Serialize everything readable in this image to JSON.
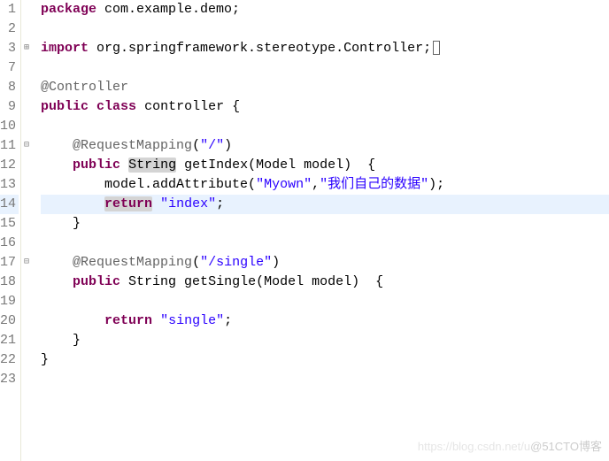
{
  "lines": [
    {
      "n": "1",
      "marker": ""
    },
    {
      "n": "2",
      "marker": ""
    },
    {
      "n": "3",
      "marker": "plus"
    },
    {
      "n": "7",
      "marker": ""
    },
    {
      "n": "8",
      "marker": ""
    },
    {
      "n": "9",
      "marker": ""
    },
    {
      "n": "10",
      "marker": ""
    },
    {
      "n": "11",
      "marker": "minus"
    },
    {
      "n": "12",
      "marker": ""
    },
    {
      "n": "13",
      "marker": ""
    },
    {
      "n": "14",
      "marker": ""
    },
    {
      "n": "15",
      "marker": ""
    },
    {
      "n": "16",
      "marker": ""
    },
    {
      "n": "17",
      "marker": "minus"
    },
    {
      "n": "18",
      "marker": ""
    },
    {
      "n": "19",
      "marker": ""
    },
    {
      "n": "20",
      "marker": ""
    },
    {
      "n": "21",
      "marker": ""
    },
    {
      "n": "22",
      "marker": ""
    },
    {
      "n": "23",
      "marker": ""
    }
  ],
  "code": {
    "l1": {
      "kw1": "package",
      "pkg": " com.example.demo;"
    },
    "l3": {
      "kw1": "import",
      "pkg": " org.springframework.stereotype.Controller;"
    },
    "l8": {
      "ann": "@Controller"
    },
    "l9": {
      "kw1": "public",
      "kw2": "class",
      "name": " controller {"
    },
    "l11": {
      "ann": "@RequestMapping",
      "args": "(",
      "str": "\"/\"",
      "close": ")"
    },
    "l12": {
      "kw1": "public",
      "type": "String",
      "rest": " getIndex(Model model)  {"
    },
    "l13": {
      "pre": "model.addAttribute(",
      "str1": "\"Myown\"",
      "mid": ",",
      "str2": "\"我们自己的数据\"",
      "post": ");"
    },
    "l14": {
      "kw1": "return",
      "sp": " ",
      "str": "\"index\"",
      "post": ";"
    },
    "l15": {
      "txt": "}"
    },
    "l17": {
      "ann": "@RequestMapping",
      "args": "(",
      "str": "\"/single\"",
      "close": ")"
    },
    "l18": {
      "kw1": "public",
      "type": " String getSingle(Model model)  {"
    },
    "l20": {
      "kw1": "return",
      "sp": " ",
      "str": "\"single\"",
      "post": ";"
    },
    "l21": {
      "txt": "}"
    },
    "l22": {
      "txt": "}"
    }
  },
  "watermark": {
    "faint": "https://blog.csdn.net/u",
    "main": "@51CTO博客"
  }
}
